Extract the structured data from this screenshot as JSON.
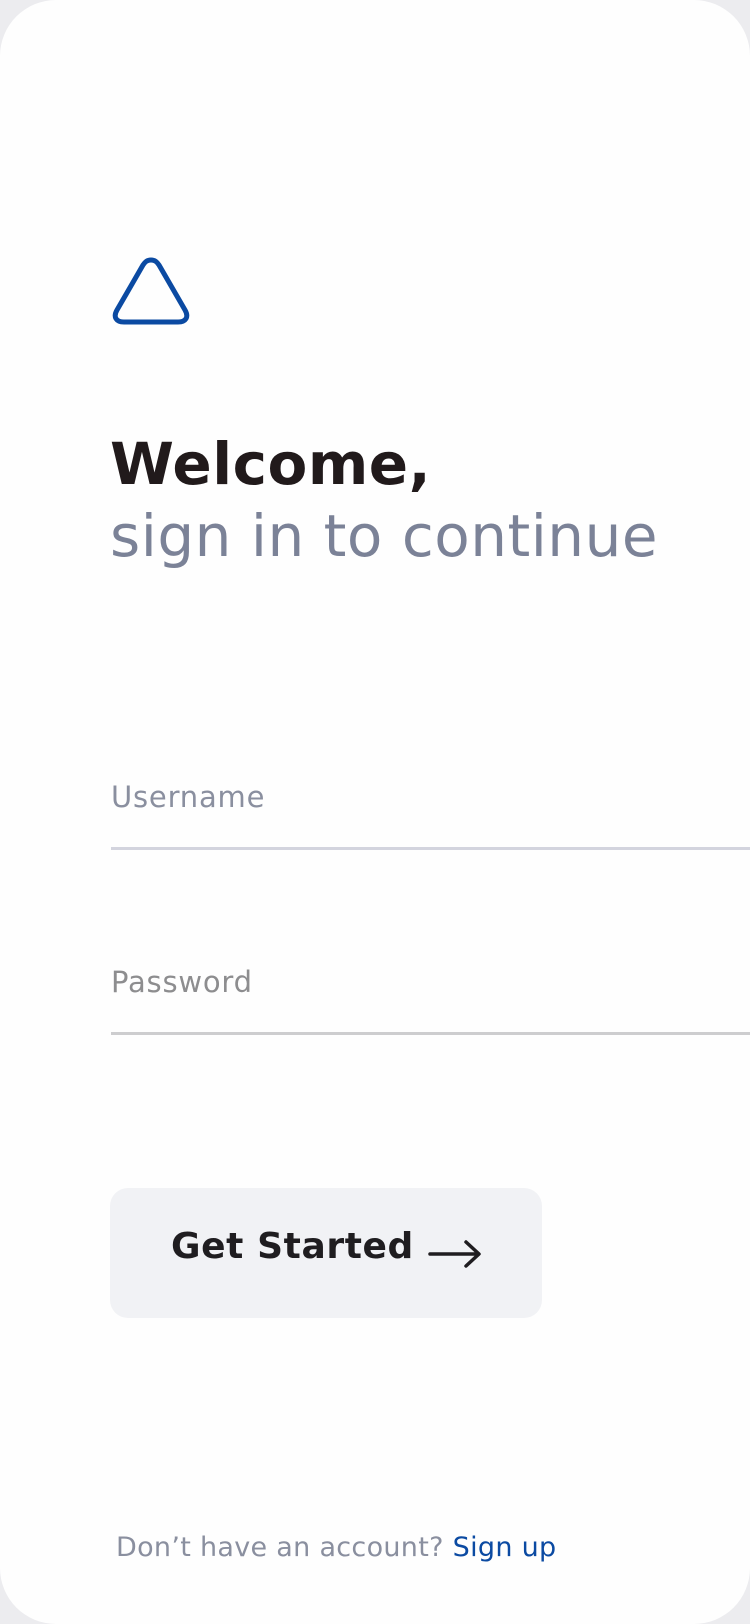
{
  "logo": {
    "icon": "triangle-logo-icon",
    "color": "#0b4aa2"
  },
  "header": {
    "title": "Welcome,",
    "subtitle": "sign in to continue"
  },
  "form": {
    "username": {
      "placeholder": "Username",
      "value": ""
    },
    "password": {
      "placeholder": "Password",
      "value": ""
    }
  },
  "cta": {
    "label": "Get Started",
    "icon": "arrow-right-icon"
  },
  "footer": {
    "prompt": "Don’t have an account?",
    "link_label": "Sign up"
  },
  "colors": {
    "accent": "#0b4aa2",
    "heading": "#211a1b",
    "subheading": "#7b8297",
    "button_bg": "#f1f2f5"
  }
}
